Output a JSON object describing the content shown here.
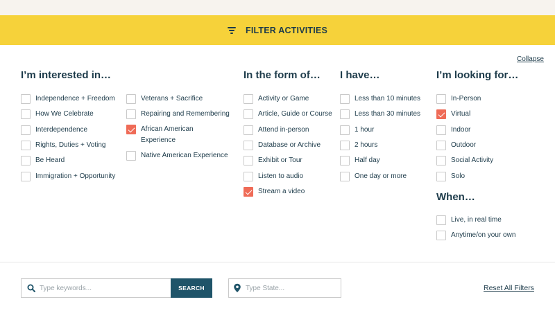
{
  "header": {
    "filter_icon": "filter-lines-icon",
    "title": "FILTER ACTIVITIES",
    "collapse_label": "Collapse"
  },
  "groups": {
    "interested": {
      "title": "I’m interested in…",
      "col1": [
        {
          "label": "Independence + Freedom",
          "checked": false
        },
        {
          "label": "How We Celebrate",
          "checked": false
        },
        {
          "label": "Interdependence",
          "checked": false
        },
        {
          "label": "Rights, Duties + Voting",
          "checked": false
        },
        {
          "label": "Be Heard",
          "checked": false
        },
        {
          "label": "Immigration + Opportunity",
          "checked": false
        }
      ],
      "col2": [
        {
          "label": "Veterans + Sacrifice",
          "checked": false
        },
        {
          "label": "Repairing and Remembering",
          "checked": false
        },
        {
          "label": "African American Experience",
          "checked": true
        },
        {
          "label": "Native American Experience",
          "checked": false
        }
      ]
    },
    "form": {
      "title": "In the form of…",
      "items": [
        {
          "label": "Activity or Game",
          "checked": false
        },
        {
          "label": "Article, Guide or Course",
          "checked": false
        },
        {
          "label": "Attend in-person",
          "checked": false
        },
        {
          "label": "Database or Archive",
          "checked": false
        },
        {
          "label": "Exhibit or Tour",
          "checked": false
        },
        {
          "label": "Listen to audio",
          "checked": false
        },
        {
          "label": "Stream a video",
          "checked": true
        }
      ]
    },
    "have": {
      "title": "I have…",
      "items": [
        {
          "label": "Less than 10 minutes",
          "checked": false
        },
        {
          "label": "Less than 30 minutes",
          "checked": false
        },
        {
          "label": "1 hour",
          "checked": false
        },
        {
          "label": "2 hours",
          "checked": false
        },
        {
          "label": "Half day",
          "checked": false
        },
        {
          "label": "One day or more",
          "checked": false
        }
      ]
    },
    "looking": {
      "title": "I’m looking for…",
      "items": [
        {
          "label": "In-Person",
          "checked": false
        },
        {
          "label": "Virtual",
          "checked": true
        },
        {
          "label": "Indoor",
          "checked": false
        },
        {
          "label": "Outdoor",
          "checked": false
        },
        {
          "label": "Social Activity",
          "checked": false
        },
        {
          "label": "Solo",
          "checked": false
        }
      ]
    },
    "when": {
      "title": "When…",
      "items": [
        {
          "label": "Live, in real time",
          "checked": false
        },
        {
          "label": "Anytime/on your own",
          "checked": false
        }
      ]
    }
  },
  "search": {
    "icon": "search-icon",
    "placeholder": "Type keywords...",
    "button_label": "SEARCH"
  },
  "state": {
    "icon": "map-pin-icon",
    "placeholder": "Type State..."
  },
  "reset_label": "Reset All Filters",
  "colors": {
    "accent_yellow": "#f6d23a",
    "checked_coral": "#ef6b57",
    "navy_text": "#1d3b4a",
    "search_button": "#1f5469"
  }
}
